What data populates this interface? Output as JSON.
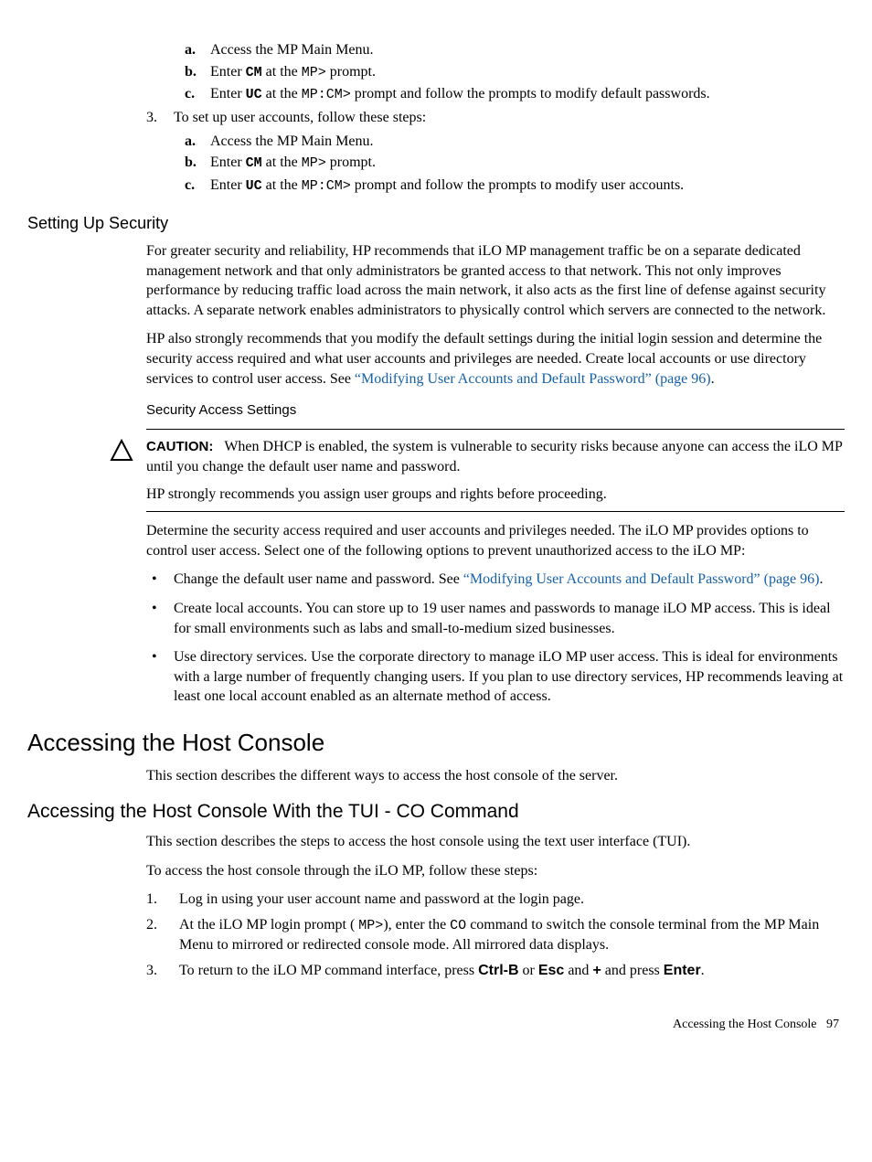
{
  "top_list": {
    "sub_a": [
      {
        "label": "a.",
        "text": "Access the MP Main Menu."
      },
      {
        "label": "b.",
        "pre": "Enter ",
        "cmd": "CM",
        "mid": " at the ",
        "prompt": "MP>",
        "post": " prompt."
      },
      {
        "label": "c.",
        "pre": "Enter ",
        "cmd": "UC",
        "mid": " at the ",
        "prompt": "MP:CM>",
        "post": " prompt and follow the prompts to modify default passwords."
      }
    ],
    "item3_num": "3.",
    "item3_text": "To set up user accounts, follow these steps:",
    "sub_b": [
      {
        "label": "a.",
        "text": "Access the MP Main Menu."
      },
      {
        "label": "b.",
        "pre": "Enter ",
        "cmd": "CM",
        "mid": " at the ",
        "prompt": "MP>",
        "post": " prompt."
      },
      {
        "label": "c.",
        "pre": "Enter ",
        "cmd": "UC",
        "mid": " at the ",
        "prompt": "MP:CM>",
        "post": " prompt and follow the prompts to modify user accounts."
      }
    ]
  },
  "security_heading": "Setting Up Security",
  "security_p1": "For greater security and reliability, HP recommends that iLO MP management traffic be on a separate dedicated management network and that only administrators be granted access to that network. This not only improves performance by reducing traffic load across the main network, it also acts as the first line of defense against security attacks. A separate network enables administrators to physically control which servers are connected to the network.",
  "security_p2_a": "HP also strongly recommends that you modify the default settings during the initial login session and determine the security access required and what user accounts and privileges are needed. Create local accounts or use directory services to control user access. See ",
  "security_p2_link": "“Modifying User Accounts and Default Password” (page 96)",
  "security_p2_b": ".",
  "sas_heading": "Security Access Settings",
  "caution_label": "CAUTION:",
  "caution_p1": "When DHCP is enabled, the system is vulnerable to security risks because anyone can access the iLO MP until you change the default user name and password.",
  "caution_p2": "HP strongly recommends you assign user groups and rights before proceeding.",
  "determine_p": "Determine the security access required and user accounts and privileges needed. The iLO MP provides options to control user access. Select one of the following options to prevent unauthorized access to the iLO MP:",
  "bullet1_a": "Change the default user name and password. See ",
  "bullet1_link": "“Modifying User Accounts and Default Password” (page 96)",
  "bullet1_b": ".",
  "bullet2": "Create local accounts. You can store up to 19 user names and passwords to manage iLO MP access. This is ideal for small environments such as labs and small-to-medium sized businesses.",
  "bullet3": "Use directory services. Use the corporate directory to manage iLO MP user access. This is ideal for environments with a large number of frequently changing users. If you plan to use directory services, HP recommends leaving at least one local account enabled as an alternate method of access.",
  "h1": "Accessing the Host Console",
  "h1_p": "This section describes the different ways to access the host console of the server.",
  "h2": "Accessing the Host Console With the TUI - CO Command",
  "h2_p1": "This section describes the steps to access the host console using the text user interface (TUI).",
  "h2_p2": "To access the host console through the iLO MP, follow these steps:",
  "steps": {
    "s1n": "1.",
    "s1": "Log in using your user account name and password at the login page.",
    "s2n": "2.",
    "s2a": "At the iLO MP login prompt ( ",
    "s2prompt": "MP>",
    "s2b": "), enter the ",
    "s2cmd": "CO",
    "s2c": " command to switch the console terminal from the MP Main Menu to mirrored or redirected console mode. All mirrored data displays.",
    "s3n": "3.",
    "s3a": "To return to the iLO MP command interface, press ",
    "s3k1": "Ctrl-B",
    "s3b": " or ",
    "s3k2": "Esc",
    "s3c": " and ",
    "s3k3": "+",
    "s3d": " and press ",
    "s3k4": "Enter",
    "s3e": "."
  },
  "footer_text": "Accessing the Host Console",
  "footer_page": "97"
}
